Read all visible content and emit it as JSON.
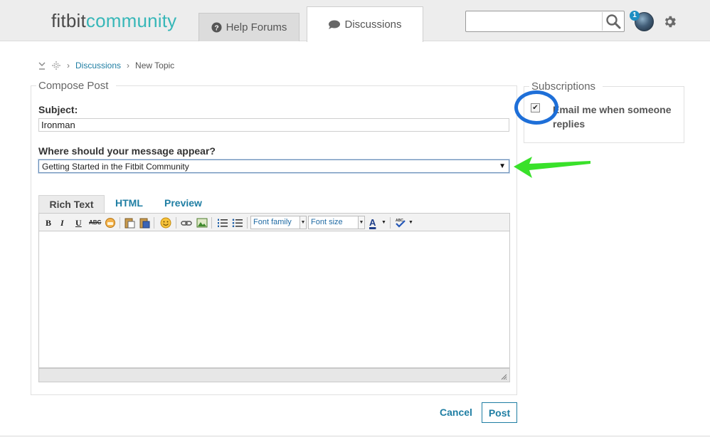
{
  "header": {
    "logo_part1": "fitbit",
    "logo_part2": "community",
    "tabs": [
      {
        "label": "Help Forums",
        "icon": "question-circle-icon"
      },
      {
        "label": "Discussions",
        "icon": "speech-bubble-icon"
      }
    ],
    "search": {
      "value": "",
      "placeholder": ""
    },
    "notification_count": "1",
    "colors": {
      "brand_teal": "#37b7b8",
      "link": "#1f7ea3"
    }
  },
  "breadcrumb": {
    "items": [
      {
        "label": "Discussions"
      },
      {
        "label": "New Topic"
      }
    ]
  },
  "compose": {
    "legend": "Compose Post",
    "subject_label": "Subject:",
    "subject_value": "Ironman",
    "location_label": "Where should your message appear?",
    "location_selected": "Getting Started in the Fitbit Community"
  },
  "editor": {
    "tabs": [
      "Rich Text",
      "HTML",
      "Preview"
    ],
    "toolbar": {
      "bold": "B",
      "italic": "I",
      "underline": "U",
      "strike": "ABC",
      "font_family": "Font family",
      "font_size": "Font size",
      "text_color": "A"
    },
    "body": ""
  },
  "actions": {
    "cancel": "Cancel",
    "post": "Post"
  },
  "subscriptions": {
    "legend": "Subscriptions",
    "email_label": "Email me when someone replies",
    "email_checked": true
  },
  "annotations": {
    "circle_color": "#1e6fd8",
    "arrow_color": "#39e12a"
  }
}
